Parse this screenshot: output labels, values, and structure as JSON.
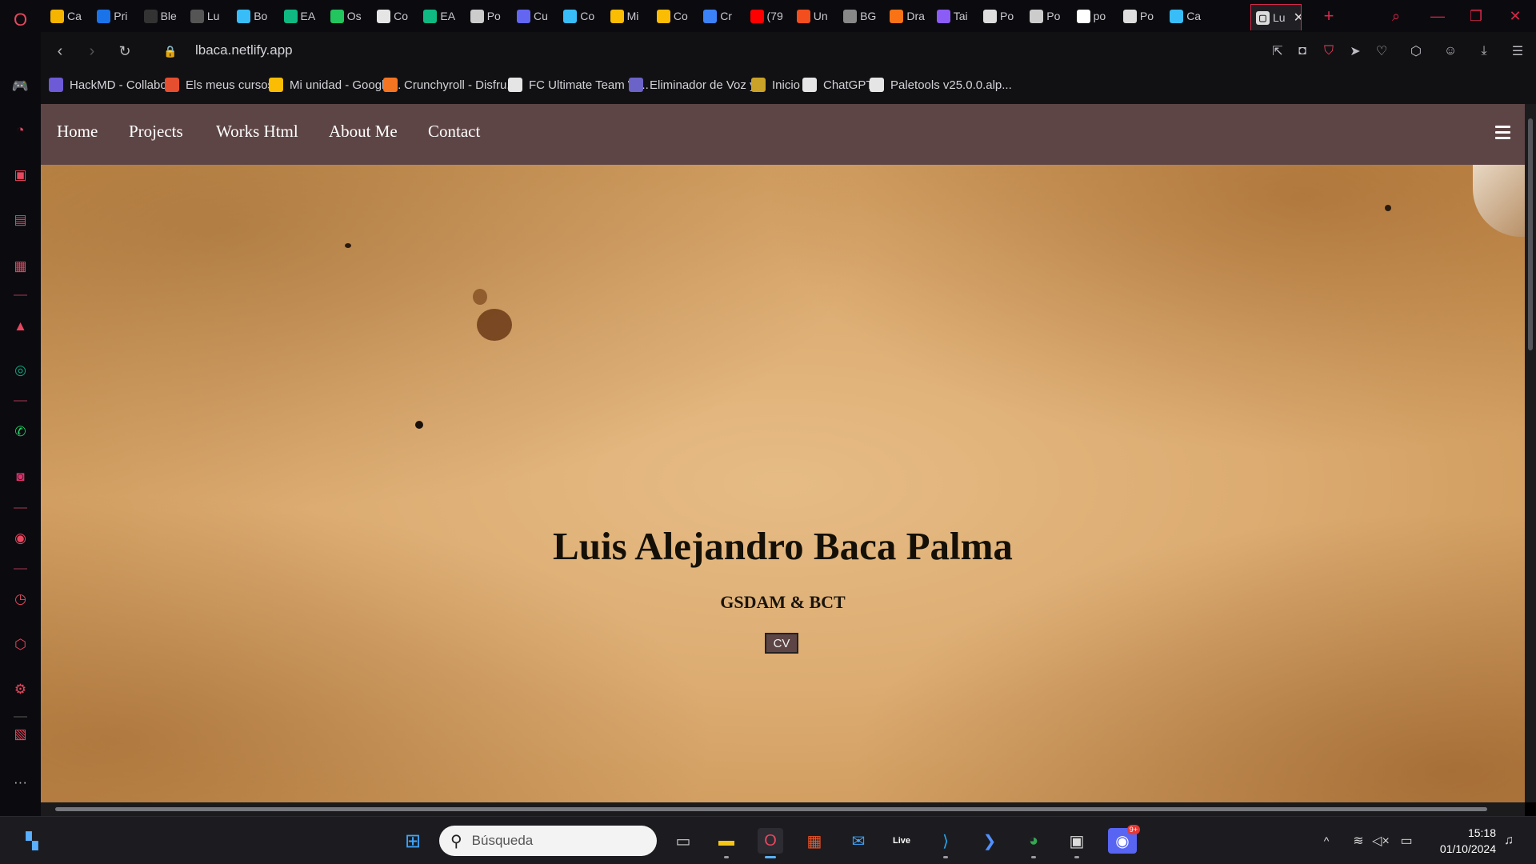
{
  "tabs": [
    {
      "label": "Ca",
      "icon": "a-icon",
      "color": "#f4b400"
    },
    {
      "label": "Pri",
      "icon": "play-icon",
      "color": "#1a73e8"
    },
    {
      "label": "Ble",
      "icon": "af-icon",
      "color": "#333"
    },
    {
      "label": "Lu",
      "icon": "page-icon",
      "color": "#555"
    },
    {
      "label": "Bo",
      "icon": "wave-icon",
      "color": "#38bdf8"
    },
    {
      "label": "EA",
      "icon": "f-icon",
      "color": "#10b981"
    },
    {
      "label": "Os",
      "icon": "q-icon",
      "color": "#22c55e"
    },
    {
      "label": "Co",
      "icon": "c-icon",
      "color": "#e5e5e5"
    },
    {
      "label": "EA",
      "icon": "f-icon",
      "color": "#10b981"
    },
    {
      "label": "Po",
      "icon": "code-icon",
      "color": "#ccc"
    },
    {
      "label": "Cu",
      "icon": "app-icon",
      "color": "#6366f1"
    },
    {
      "label": "Co",
      "icon": "wave-icon",
      "color": "#38bdf8"
    },
    {
      "label": "Mi",
      "icon": "drive-icon",
      "color": "#fbbc04"
    },
    {
      "label": "Co",
      "icon": "drive-icon",
      "color": "#fbbc04"
    },
    {
      "label": "Cr",
      "icon": "circle-icon",
      "color": "#3b82f6"
    },
    {
      "label": "(79",
      "icon": "youtube-icon",
      "color": "#ff0000"
    },
    {
      "label": "Un",
      "icon": "figma-icon",
      "color": "#f24e1e"
    },
    {
      "label": "BG",
      "icon": "hash-icon",
      "color": "#888"
    },
    {
      "label": "Dra",
      "icon": "fire-icon",
      "color": "#f97316"
    },
    {
      "label": "Tai",
      "icon": "chat-icon",
      "color": "#8b5cf6"
    },
    {
      "label": "Po",
      "icon": "rocket-icon",
      "color": "#ddd"
    },
    {
      "label": "Po",
      "icon": "code-icon",
      "color": "#ccc"
    },
    {
      "label": "po",
      "icon": "github-icon",
      "color": "#fff"
    },
    {
      "label": "Po",
      "icon": "rocket-icon",
      "color": "#ddd"
    },
    {
      "label": "Ca",
      "icon": "wave-icon",
      "color": "#38bdf8"
    }
  ],
  "active_tab": {
    "label": "Lu"
  },
  "addressbar": {
    "url": "lbaca.netlify.app"
  },
  "bookmarks": [
    {
      "label": "HackMD - Collabor...",
      "icon": "hackmd-icon",
      "color": "#6d5ad6"
    },
    {
      "label": "Els meus cursos",
      "icon": "e-icon",
      "color": "#e54e2e"
    },
    {
      "label": "Mi unidad - Google...",
      "icon": "drive-icon",
      "color": "#fbbc04"
    },
    {
      "label": "Crunchyroll - Disfru...",
      "icon": "crunchyroll-icon",
      "color": "#f47521"
    },
    {
      "label": "FC Ultimate Team W...",
      "icon": "page-icon",
      "color": "#e5e5e5"
    },
    {
      "label": "Eliminador de Voz y...",
      "icon": "v-icon",
      "color": "#6b63c8"
    },
    {
      "label": "Inicio",
      "icon": "image-icon",
      "color": "#c9a227"
    },
    {
      "label": "ChatGPT",
      "icon": "chatgpt-icon",
      "color": "#e5e5e5"
    },
    {
      "label": "Paletools v25.0.0.alp...",
      "icon": "page-icon",
      "color": "#e5e5e5"
    }
  ],
  "site": {
    "nav": [
      "Home",
      "Projects",
      "Works Html",
      "About Me",
      "Contact"
    ],
    "title": "Luis Alejandro Baca Palma",
    "subtitle": "GSDAM & BCT",
    "cv_button": "CV"
  },
  "taskbar": {
    "search_placeholder": "Búsqueda",
    "time": "15:18",
    "date": "01/10/2024",
    "discord_badge": "9+"
  },
  "colors": {
    "accent": "#d6284a",
    "site_nav_bg": "#5e4545"
  }
}
